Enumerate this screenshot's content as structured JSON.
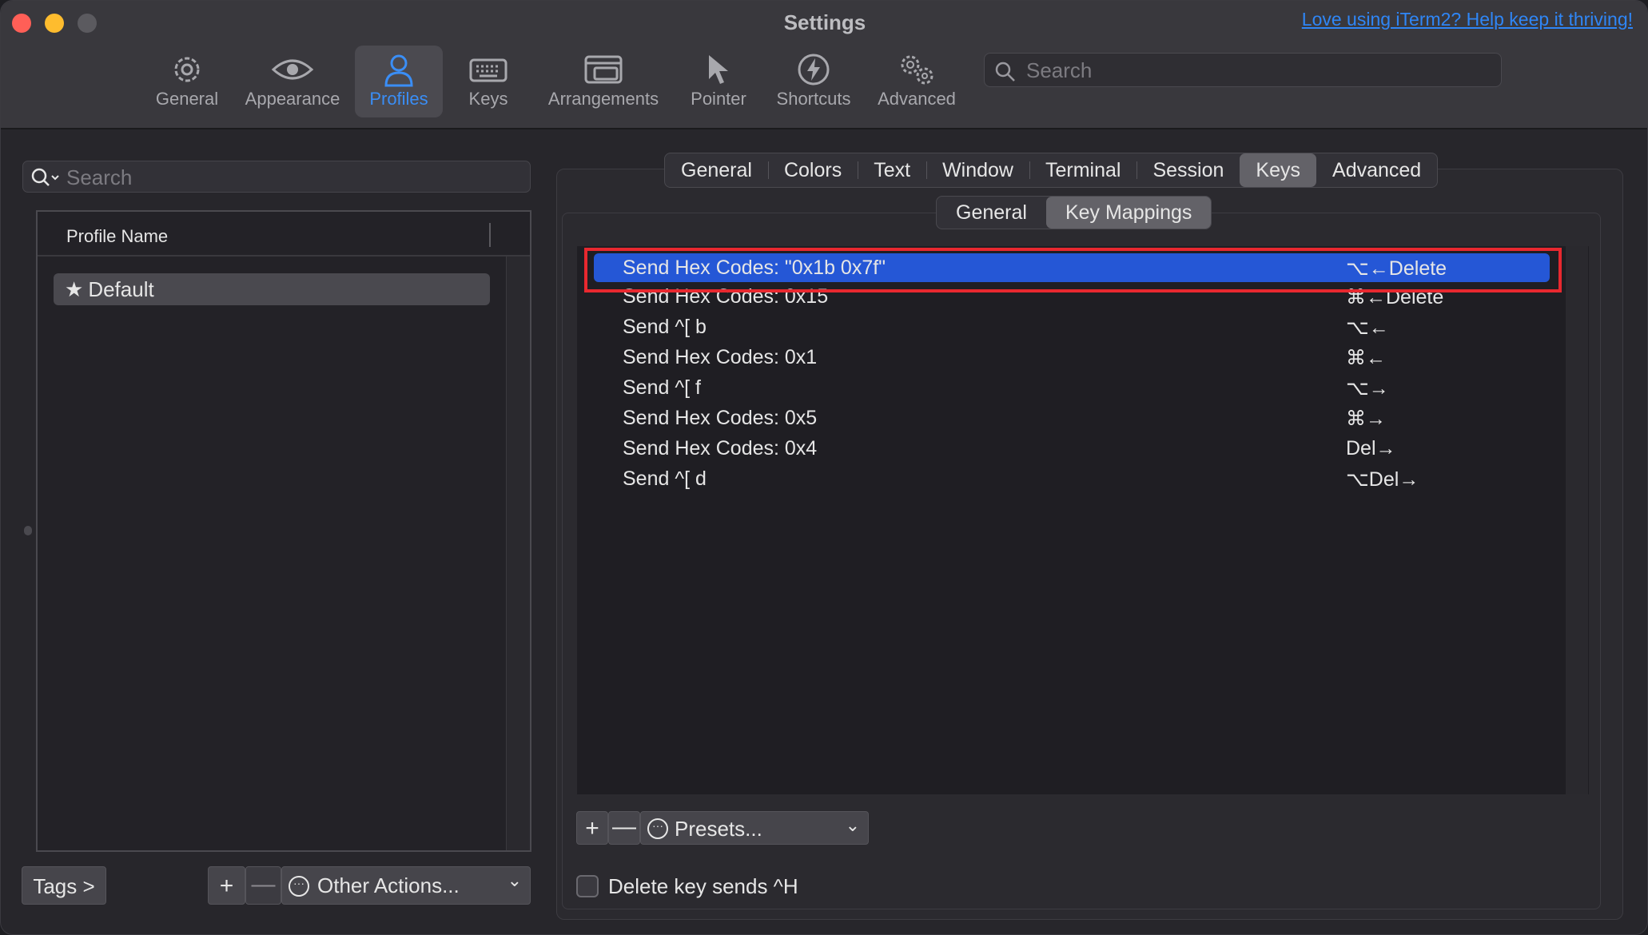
{
  "window": {
    "title": "Settings",
    "donate_link": "Love using iTerm2? Help keep it thriving!"
  },
  "toolbar": {
    "items": [
      {
        "label": "General",
        "icon": "gear-icon"
      },
      {
        "label": "Appearance",
        "icon": "eye-icon"
      },
      {
        "label": "Profiles",
        "icon": "person-icon",
        "active": true
      },
      {
        "label": "Keys",
        "icon": "keyboard-icon"
      },
      {
        "label": "Arrangements",
        "icon": "windows-icon"
      },
      {
        "label": "Pointer",
        "icon": "pointer-icon"
      },
      {
        "label": "Shortcuts",
        "icon": "bolt-icon"
      },
      {
        "label": "Advanced",
        "icon": "gears-icon"
      }
    ],
    "search_placeholder": "Search"
  },
  "sidebar": {
    "search_placeholder": "Search",
    "column_header": "Profile Name",
    "profiles": [
      {
        "name": "Default",
        "default": true
      }
    ],
    "tags_button": "Tags >",
    "add_button": "+",
    "remove_button": "—",
    "actions_button": "Other Actions..."
  },
  "profile_tabs": {
    "tabs": [
      "General",
      "Colors",
      "Text",
      "Window",
      "Terminal",
      "Session",
      "Keys",
      "Advanced"
    ],
    "active": "Keys"
  },
  "keys_subtabs": {
    "tabs": [
      "General",
      "Key Mappings"
    ],
    "active": "Key Mappings"
  },
  "key_mappings": [
    {
      "action": "Send Hex Codes: \"0x1b 0x7f\"",
      "key": "⌥←Delete",
      "selected": true
    },
    {
      "action": "Send Hex Codes: 0x15",
      "key": "⌘←Delete"
    },
    {
      "action": "Send ^[ b",
      "key": "⌥←"
    },
    {
      "action": "Send Hex Codes: 0x1",
      "key": "⌘←"
    },
    {
      "action": "Send ^[ f",
      "key": "⌥→"
    },
    {
      "action": "Send Hex Codes: 0x5",
      "key": "⌘→"
    },
    {
      "action": "Send Hex Codes: 0x4",
      "key": "Del→"
    },
    {
      "action": "Send ^[ d",
      "key": "⌥Del→"
    }
  ],
  "mapping_controls": {
    "add_button": "+",
    "remove_button": "—",
    "presets_button": "Presets..."
  },
  "options": {
    "delete_sends_ctrl_h_label": "Delete key sends ^H",
    "delete_sends_ctrl_h_checked": false
  },
  "colors": {
    "accent": "#3a8ef6",
    "selection": "#2557d6",
    "highlight_border": "#e8282f"
  }
}
